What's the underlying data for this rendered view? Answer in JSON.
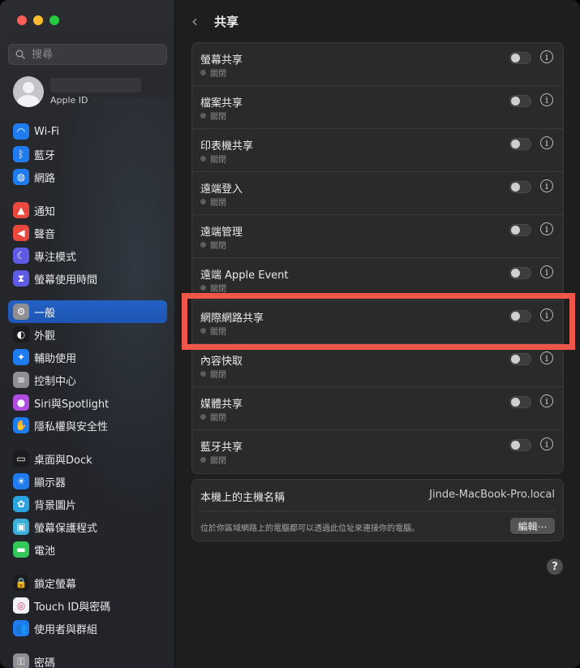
{
  "sidebar": {
    "search_placeholder": "搜尋",
    "account": {
      "subtitle": "Apple ID"
    },
    "items": [
      {
        "label": "Wi-Fi",
        "icon": "wifi-icon",
        "color": "#1e7bf0",
        "glyph": "◠"
      },
      {
        "label": "藍牙",
        "icon": "bluetooth-icon",
        "color": "#1e7bf0",
        "glyph": "ᛒ"
      },
      {
        "label": "網路",
        "icon": "network-icon",
        "color": "#1e7bf0",
        "glyph": "◍"
      },
      {
        "label": "通知",
        "icon": "notifications-icon",
        "color": "#e9483f",
        "glyph": "▲"
      },
      {
        "label": "聲音",
        "icon": "sound-icon",
        "color": "#e9483f",
        "glyph": "◀"
      },
      {
        "label": "專注模式",
        "icon": "focus-icon",
        "color": "#5e5ce6",
        "glyph": "☾"
      },
      {
        "label": "螢幕使用時間",
        "icon": "screen-time-icon",
        "color": "#5e5ce6",
        "glyph": "⧗"
      },
      {
        "label": "一般",
        "icon": "general-icon",
        "color": "#8e8e93",
        "glyph": "⚙"
      },
      {
        "label": "外觀",
        "icon": "appearance-icon",
        "color": "#1c1c1e",
        "glyph": "◐"
      },
      {
        "label": "輔助使用",
        "icon": "accessibility-icon",
        "color": "#1e7bf0",
        "glyph": "✦"
      },
      {
        "label": "控制中心",
        "icon": "control-center-icon",
        "color": "#8e8e93",
        "glyph": "≡"
      },
      {
        "label": "Siri與Spotlight",
        "icon": "siri-icon",
        "color": "#b04ce0",
        "glyph": "●"
      },
      {
        "label": "隱私權與安全性",
        "icon": "privacy-hand-icon",
        "color": "#1e7bf0",
        "glyph": "✋"
      },
      {
        "label": "桌面與Dock",
        "icon": "desktop-dock-icon",
        "color": "#1c1c1e",
        "glyph": "▭"
      },
      {
        "label": "顯示器",
        "icon": "displays-icon",
        "color": "#1e7bf0",
        "glyph": "☀"
      },
      {
        "label": "背景圖片",
        "icon": "wallpaper-icon",
        "color": "#2aa3e0",
        "glyph": "✿"
      },
      {
        "label": "螢幕保護程式",
        "icon": "screensaver-icon",
        "color": "#3ab0d8",
        "glyph": "▣"
      },
      {
        "label": "電池",
        "icon": "battery-icon",
        "color": "#34c759",
        "glyph": "▬"
      },
      {
        "label": "鎖定螢幕",
        "icon": "lock-screen-icon",
        "color": "#1c1c1e",
        "glyph": "🔒"
      },
      {
        "label": "Touch ID與密碼",
        "icon": "touch-id-icon",
        "color": "#f2f2f4",
        "glyph": "◎"
      },
      {
        "label": "使用者與群組",
        "icon": "users-groups-icon",
        "color": "#1e7bf0",
        "glyph": "👥"
      },
      {
        "label": "密碼",
        "icon": "passwords-icon",
        "color": "#8e8e93",
        "glyph": "⚿"
      }
    ]
  },
  "header": {
    "title": "共享"
  },
  "services": [
    {
      "label": "螢幕共享",
      "status": "關閉"
    },
    {
      "label": "檔案共享",
      "status": "關閉"
    },
    {
      "label": "印表機共享",
      "status": "關閉"
    },
    {
      "label": "遠端登入",
      "status": "關閉"
    },
    {
      "label": "遠端管理",
      "status": "關閉"
    },
    {
      "label": "遠端 Apple Event",
      "status": "關閉"
    },
    {
      "label": "網際網路共享",
      "status": "關閉"
    },
    {
      "label": "內容快取",
      "status": "關閉"
    },
    {
      "label": "媒體共享",
      "status": "關閉"
    },
    {
      "label": "藍牙共享",
      "status": "關閉"
    }
  ],
  "host": {
    "label": "本機上的主機名稱",
    "value": "Jinde-MacBook-Pro.local",
    "description": "位於你區域網路上的電腦都可以透過此位址來連接你的電腦。",
    "edit_label": "編輯⋯"
  },
  "help_label": "?"
}
